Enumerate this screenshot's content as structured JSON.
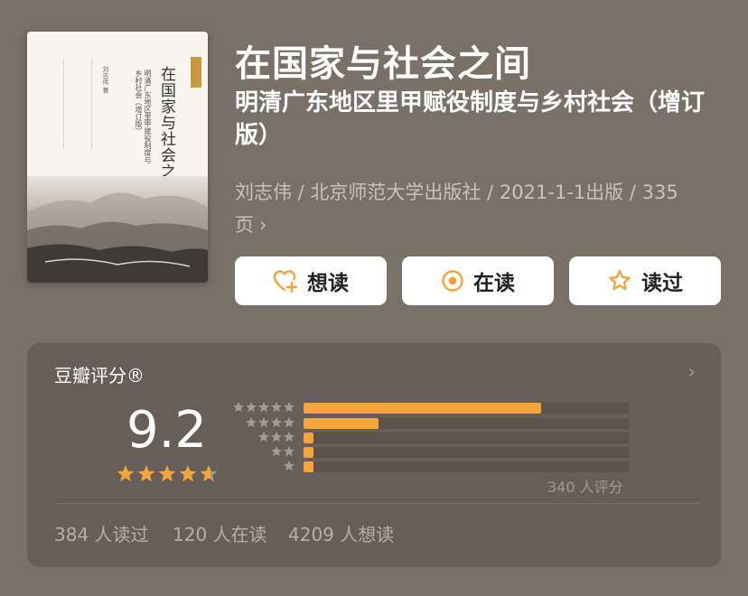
{
  "book": {
    "title": "在国家与社会之间",
    "subtitle": "明清广东地区里甲赋役制度与乡村社会（增订版）",
    "meta": "刘志伟 / 北京师范大学出版社 / 2021-1-1出版 / 335页",
    "cover": {
      "title": "在国家与社会之间",
      "subtitle": "明清广东地区里甲赋役制度与乡村社会（增订版）",
      "author": "刘志伟 著"
    }
  },
  "buttons": {
    "want": "想读",
    "reading": "在读",
    "read": "读过"
  },
  "rating": {
    "label": "豆瓣评分®",
    "score": "9.2",
    "stars_value": 4.6,
    "count_text": "340 人评分",
    "distribution": [
      {
        "stars": 5,
        "fraction": 0.73
      },
      {
        "stars": 4,
        "fraction": 0.23
      },
      {
        "stars": 3,
        "fraction": 0.03
      },
      {
        "stars": 2,
        "fraction": 0.03
      },
      {
        "stars": 1,
        "fraction": 0.03
      }
    ]
  },
  "stats": {
    "read": "384 人读过",
    "reading": "120 人在读",
    "want": "4209 人想读"
  },
  "colors": {
    "background": "#797068",
    "accent": "#f4a43b",
    "panel": "#665e57"
  }
}
